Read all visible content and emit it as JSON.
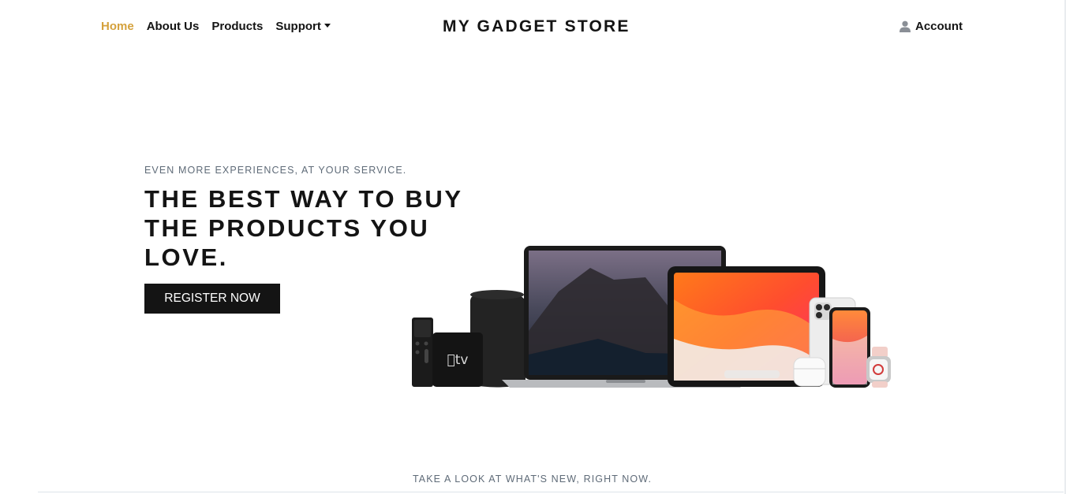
{
  "nav": {
    "links": [
      {
        "label": "Home",
        "active": true
      },
      {
        "label": "About Us",
        "active": false
      },
      {
        "label": "Products",
        "active": false
      },
      {
        "label": "Support",
        "active": false,
        "dropdown": true
      }
    ],
    "brand": "MY GADGET STORE",
    "account_label": "Account",
    "account_icon": "user-icon"
  },
  "hero": {
    "eyebrow": "EVEN MORE EXPERIENCES, AT YOUR SERVICE.",
    "headline": "THE BEST WAY TO BUY THE PRODUCTS YOU LOVE.",
    "cta_label": "REGISTER NOW",
    "image_alt": "Apple devices lineup",
    "apple_tv_logo": "tv"
  },
  "section": {
    "tagline": "TAKE A LOOK AT WHAT'S NEW, RIGHT NOW."
  },
  "colors": {
    "accent": "#d4a13c",
    "text": "#141414",
    "muted": "#5f6b78",
    "button_bg": "#141414"
  }
}
